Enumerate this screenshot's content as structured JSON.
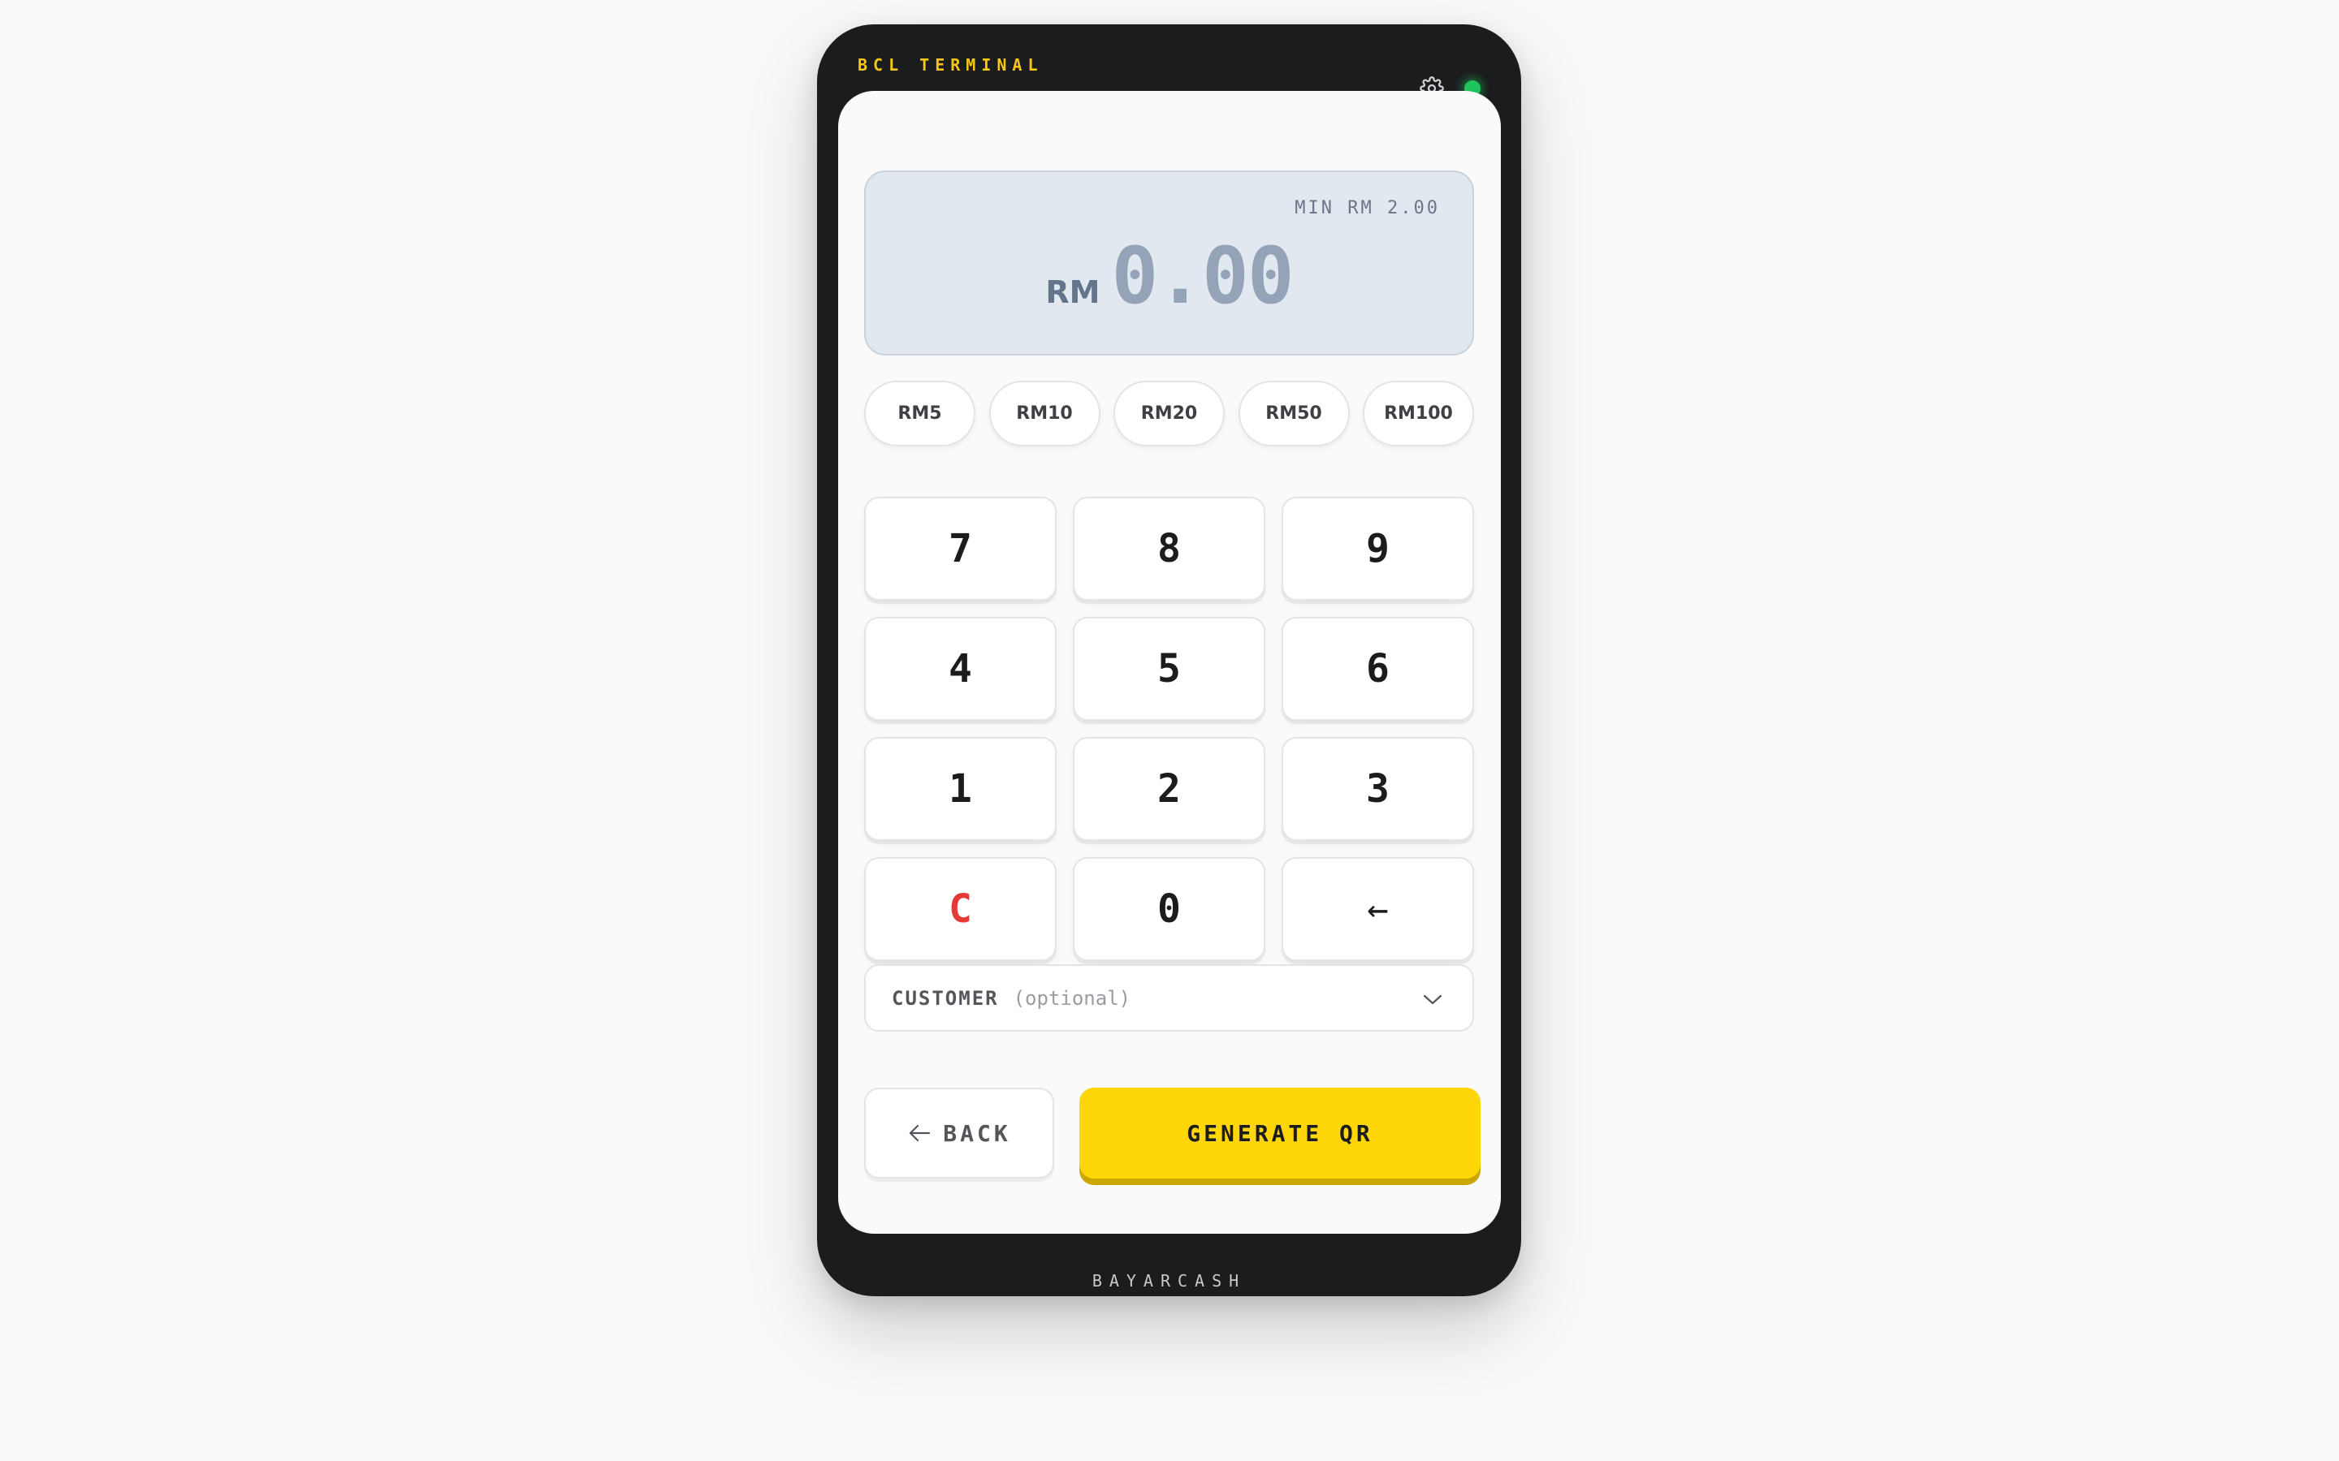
{
  "header": {
    "brand": "BCL TERMINAL",
    "settings_icon": "gear-icon",
    "status": "online",
    "status_color": "#1ec45c"
  },
  "display": {
    "min_label": "MIN RM 2.00",
    "currency": "RM",
    "amount": "0.00"
  },
  "quick_amounts": [
    "RM5",
    "RM10",
    "RM20",
    "RM50",
    "RM100"
  ],
  "keypad": {
    "keys": [
      "7",
      "8",
      "9",
      "4",
      "5",
      "6",
      "1",
      "2",
      "3",
      "C",
      "0",
      "←"
    ]
  },
  "customer": {
    "label": "CUSTOMER",
    "hint": "(optional)",
    "icon": "chevron-down-icon"
  },
  "actions": {
    "back_label": "BACK",
    "back_icon": "arrow-left-icon",
    "generate_label": "GENERATE QR"
  },
  "footer": {
    "brand": "BAYARCASH"
  },
  "colors": {
    "accent": "#ffd60a",
    "clear": "#e53935",
    "brand": "#f5c518",
    "device": "#1b1c1e"
  }
}
